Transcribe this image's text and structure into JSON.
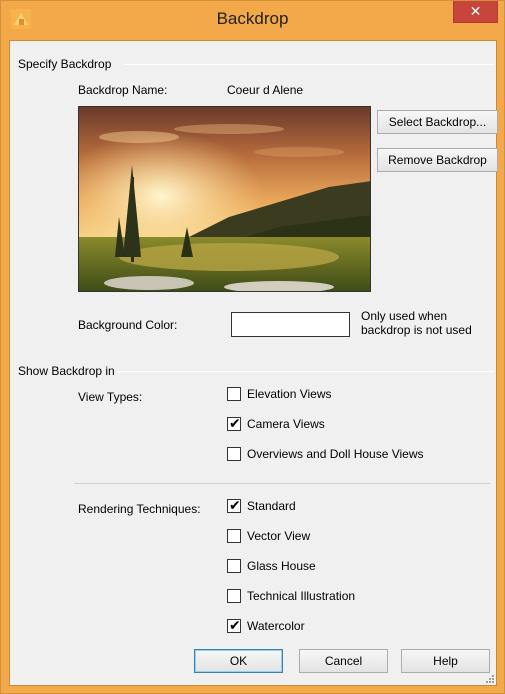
{
  "window": {
    "title": "Backdrop",
    "close_label": "✕"
  },
  "specify_group": {
    "heading": "Specify Backdrop",
    "name_label": "Backdrop Name:",
    "name_value": "Coeur d Alene",
    "select_button": "Select Backdrop...",
    "remove_button": "Remove Backdrop",
    "bg_color_label": "Background Color:",
    "bg_color_value": "#ffffff",
    "bg_note_line1": "Only used when",
    "bg_note_line2": "backdrop is not used"
  },
  "show_group": {
    "heading": "Show Backdrop in",
    "view_types_label": "View Types:",
    "view_types": [
      {
        "label": "Elevation Views",
        "checked": false
      },
      {
        "label": "Camera Views",
        "checked": true
      },
      {
        "label": "Overviews and Doll House Views",
        "checked": false
      }
    ],
    "rendering_label": "Rendering Techniques:",
    "rendering": [
      {
        "label": "Standard",
        "checked": true
      },
      {
        "label": "Vector View",
        "checked": false
      },
      {
        "label": "Glass House",
        "checked": false
      },
      {
        "label": "Technical Illustration",
        "checked": false
      },
      {
        "label": "Watercolor",
        "checked": true
      }
    ]
  },
  "footer": {
    "ok": "OK",
    "cancel": "Cancel",
    "help": "Help"
  },
  "check_glyph": "✔"
}
